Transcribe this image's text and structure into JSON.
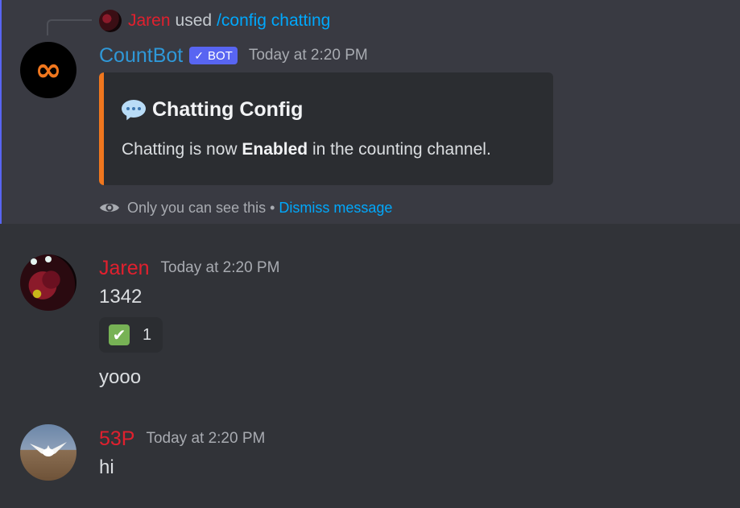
{
  "ephemeral": {
    "command": {
      "user": "Jaren",
      "used": "used",
      "name": "/config chatting"
    },
    "bot": {
      "name": "CountBot",
      "tag": "BOT",
      "timestamp": "Today at 2:20 PM",
      "logo": "∞"
    },
    "embed": {
      "accent_color": "#f0771e",
      "icon": "speech-balloon-icon",
      "title": "Chatting Config",
      "desc_before": "Chatting is now ",
      "desc_bold": "Enabled",
      "desc_after": " in the counting channel."
    },
    "note": {
      "text": "Only you can see this",
      "separator": "•",
      "dismiss": "Dismiss message"
    }
  },
  "messages": [
    {
      "author": "Jaren",
      "author_color": "#e0202e",
      "timestamp": "Today at 2:20 PM",
      "lines": [
        "1342",
        "yooo"
      ],
      "reaction": {
        "emoji": "✔",
        "count": "1"
      }
    },
    {
      "author": "53P",
      "author_color": "#e0202e",
      "timestamp": "Today at 2:20 PM",
      "lines": [
        "hi"
      ]
    }
  ],
  "colors": {
    "background": "#313338",
    "ephemeral_bg": "#393a42",
    "link": "#00a8fc",
    "bot_tag": "#5865f2"
  }
}
